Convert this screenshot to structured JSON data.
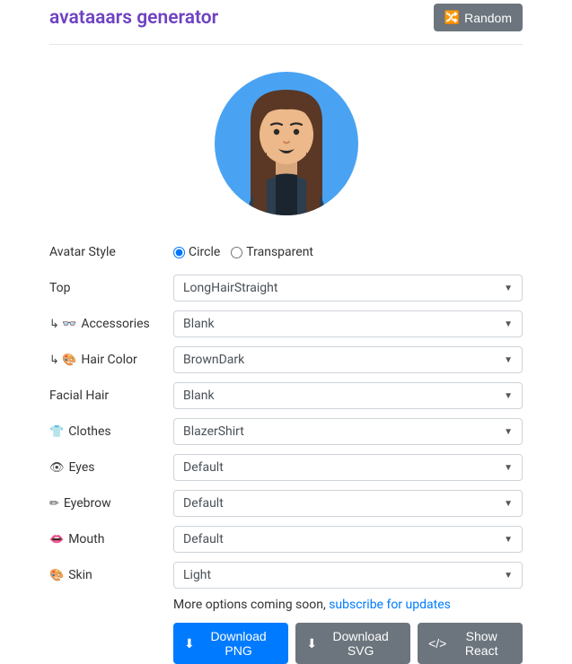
{
  "header": {
    "title": "avataaars generator",
    "random_label": "Random"
  },
  "style_row": {
    "label": "Avatar Style",
    "option_circle": "Circle",
    "option_transparent": "Transparent"
  },
  "fields": {
    "top": {
      "label": "Top",
      "value": "LongHairStraight",
      "prefix": ""
    },
    "accessories": {
      "label": "Accessories",
      "value": "Blank",
      "prefix": "↳ 👓"
    },
    "hair_color": {
      "label": "Hair Color",
      "value": "BrownDark",
      "prefix": "↳ 🎨"
    },
    "facial_hair": {
      "label": "Facial Hair",
      "value": "Blank",
      "prefix": ""
    },
    "clothes": {
      "label": "Clothes",
      "value": "BlazerShirt",
      "prefix": "👕"
    },
    "eyes": {
      "label": "Eyes",
      "value": "Default",
      "prefix": "👁"
    },
    "eyebrow": {
      "label": "Eyebrow",
      "value": "Default",
      "prefix": "✏"
    },
    "mouth": {
      "label": "Mouth",
      "value": "Default",
      "prefix": "👄"
    },
    "skin": {
      "label": "Skin",
      "value": "Light",
      "prefix": "🎨"
    }
  },
  "footer": {
    "more_text": "More options coming soon, ",
    "subscribe_link": "subscribe for updates",
    "download_png": "Download PNG",
    "download_svg": "Download SVG",
    "show_react": "Show React"
  }
}
